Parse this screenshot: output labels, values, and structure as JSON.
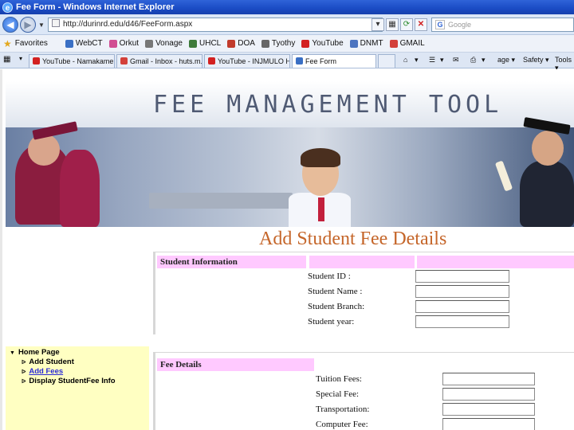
{
  "window": {
    "title": "Fee Form - Windows Internet Explorer"
  },
  "address_bar": {
    "url": "http://durinrd.edu/d46/FeeForm.aspx",
    "search_placeholder": "Google"
  },
  "favorites": {
    "label": "Favorites",
    "items": [
      {
        "label": "WebCT",
        "icon_color": "#3a6fc4"
      },
      {
        "label": "Orkut",
        "icon_color": "#d14d92"
      },
      {
        "label": "Vonage",
        "icon_color": "#777777"
      },
      {
        "label": "UHCL",
        "icon_color": "#3d7a3a"
      },
      {
        "label": "DOA",
        "icon_color": "#c13b2c"
      },
      {
        "label": "Tyothy",
        "icon_color": "#666666"
      },
      {
        "label": "YouTube",
        "icon_color": "#d32121"
      },
      {
        "label": "DNMT",
        "icon_color": "#4b74c0"
      },
      {
        "label": "GMAIL",
        "icon_color": "#d3403a"
      }
    ]
  },
  "tabs": [
    {
      "label": "YouTube - Namakame ...",
      "icon_color": "#d32121"
    },
    {
      "label": "Gmail - Inbox - huts.m...",
      "icon_color": "#d3403a"
    },
    {
      "label": "YouTube - INJMULO H...",
      "icon_color": "#d32121"
    },
    {
      "label": "Fee Form",
      "icon_color": "#3a6fc4"
    }
  ],
  "toolbar": {
    "page_label": "age",
    "safety_label": "Safety",
    "tools_label": "Tools"
  },
  "banner": {
    "title": "FEE MANAGEMENT TOOL"
  },
  "page_heading": "Add Student Fee Details",
  "student_info": {
    "header": "Student Information",
    "fields": [
      {
        "label": "Student ID :",
        "value": ""
      },
      {
        "label": "Student Name :",
        "value": ""
      },
      {
        "label": "Student Branch:",
        "value": ""
      },
      {
        "label": "Student year:",
        "value": ""
      }
    ]
  },
  "sidebar": {
    "items": [
      {
        "label": "Home Page",
        "arrow": "▼"
      },
      {
        "label": "Add Student",
        "arrow": "ᐅ"
      },
      {
        "label": "Add Fees",
        "arrow": "ᐅ"
      },
      {
        "label": "Display StudentFee Info",
        "arrow": "ᐅ"
      }
    ]
  },
  "fee_details": {
    "header": "Fee Details",
    "fields": [
      {
        "label": "Tuition Fees:",
        "value": ""
      },
      {
        "label": "Special Fee:",
        "value": ""
      },
      {
        "label": "Transportation:",
        "value": ""
      },
      {
        "label": "Computer Fee:",
        "value": ""
      }
    ]
  },
  "colors": {
    "section_header": "#ffc9ff",
    "sidebar_bg": "#ffffc2",
    "heading": "#c5662a",
    "link": "#2b2bd6"
  }
}
